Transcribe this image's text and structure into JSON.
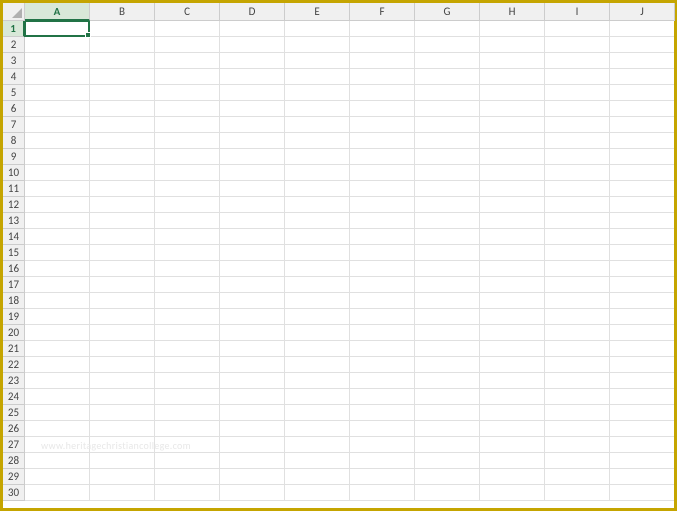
{
  "spreadsheet": {
    "columns": [
      "A",
      "B",
      "C",
      "D",
      "E",
      "F",
      "G",
      "H",
      "I",
      "J"
    ],
    "rows": [
      "1",
      "2",
      "3",
      "4",
      "5",
      "6",
      "7",
      "8",
      "9",
      "10",
      "11",
      "12",
      "13",
      "14",
      "15",
      "16",
      "17",
      "18",
      "19",
      "20",
      "21",
      "22",
      "23",
      "24",
      "25",
      "26",
      "27",
      "28",
      "29",
      "30"
    ],
    "active_cell": {
      "col": "A",
      "row": "1"
    },
    "selected_column": "A",
    "selected_row": "1",
    "accent_color": "#217346"
  },
  "watermark_text": "www.heritagechristiancollege.com"
}
